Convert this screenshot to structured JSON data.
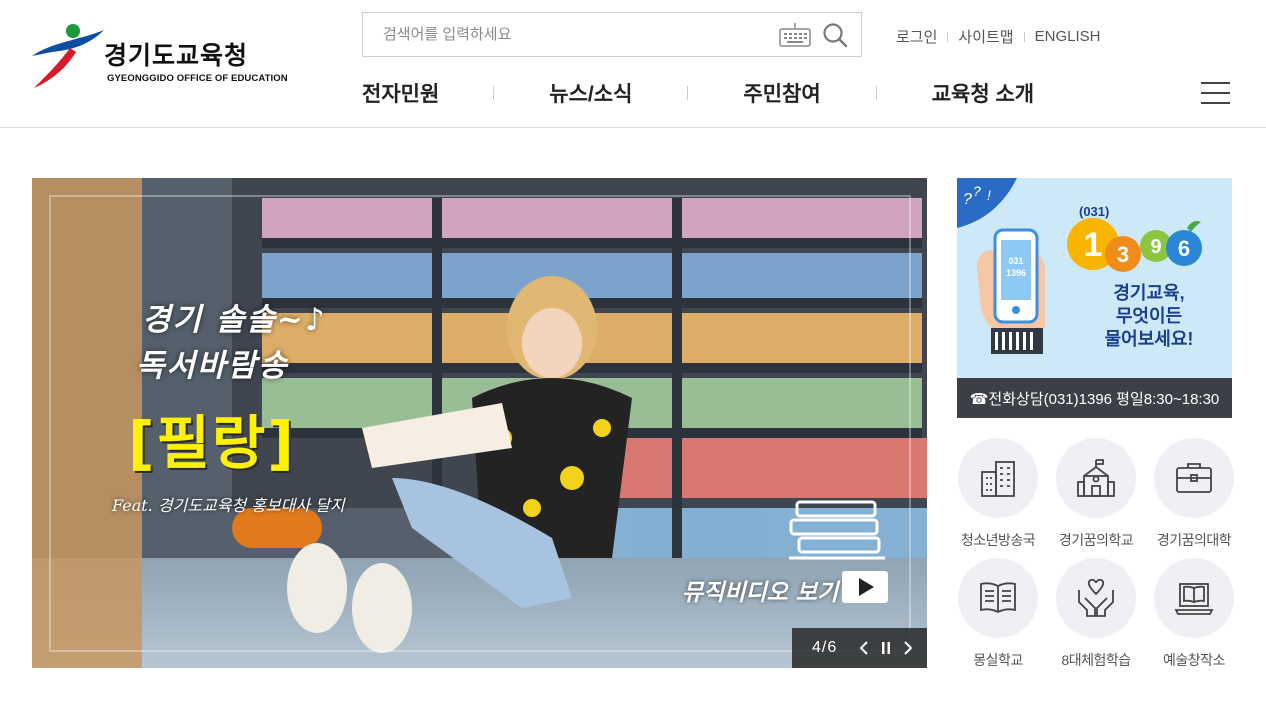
{
  "header": {
    "logo": {
      "name_ko": "경기도교육청",
      "name_en": "GYEONGGIDO OFFICE OF EDUCATION"
    },
    "search": {
      "placeholder": "검색어를 입력하세요",
      "value": ""
    },
    "util_links": [
      "로그인",
      "사이트맵",
      "ENGLISH"
    ],
    "gnb": [
      "전자민원",
      "뉴스/소식",
      "주민참여",
      "교육청 소개"
    ]
  },
  "main_visual": {
    "title_line1": "경기 솔솔~♪",
    "title_line2": "독서바람송",
    "main_title": "[필랑]",
    "feat": "Feat. 경기도교육청 홍보대사 달지",
    "mv_label": "뮤직비디오 보기",
    "pager": {
      "current": "4",
      "total": "6",
      "text": "4/6"
    }
  },
  "banner": {
    "number_prefix": "(031)",
    "number": [
      "1",
      "3",
      "9",
      "6"
    ],
    "phone_screen": [
      "031",
      "1396"
    ],
    "line1": "경기교육,",
    "line2": "무엇이든",
    "line3": "물어보세요!",
    "contact": "☎전화상담(031)1396 평일8:30~18:30"
  },
  "quick_links": [
    {
      "label": "청소년방송국",
      "icon": "building-icon"
    },
    {
      "label": "경기꿈의학교",
      "icon": "school-icon"
    },
    {
      "label": "경기꿈의대학",
      "icon": "briefcase-icon"
    },
    {
      "label": "몽실학교",
      "icon": "book-icon"
    },
    {
      "label": "8대체험학습",
      "icon": "heart-hands-icon"
    },
    {
      "label": "예술창작소",
      "icon": "laptop-icon"
    }
  ],
  "colors": {
    "accent_blue": "#1b3f8f",
    "logo_red": "#d7192a",
    "logo_blue": "#0b4ea2",
    "logo_green": "#1a9a3a",
    "headline_yellow": "#fff200"
  }
}
